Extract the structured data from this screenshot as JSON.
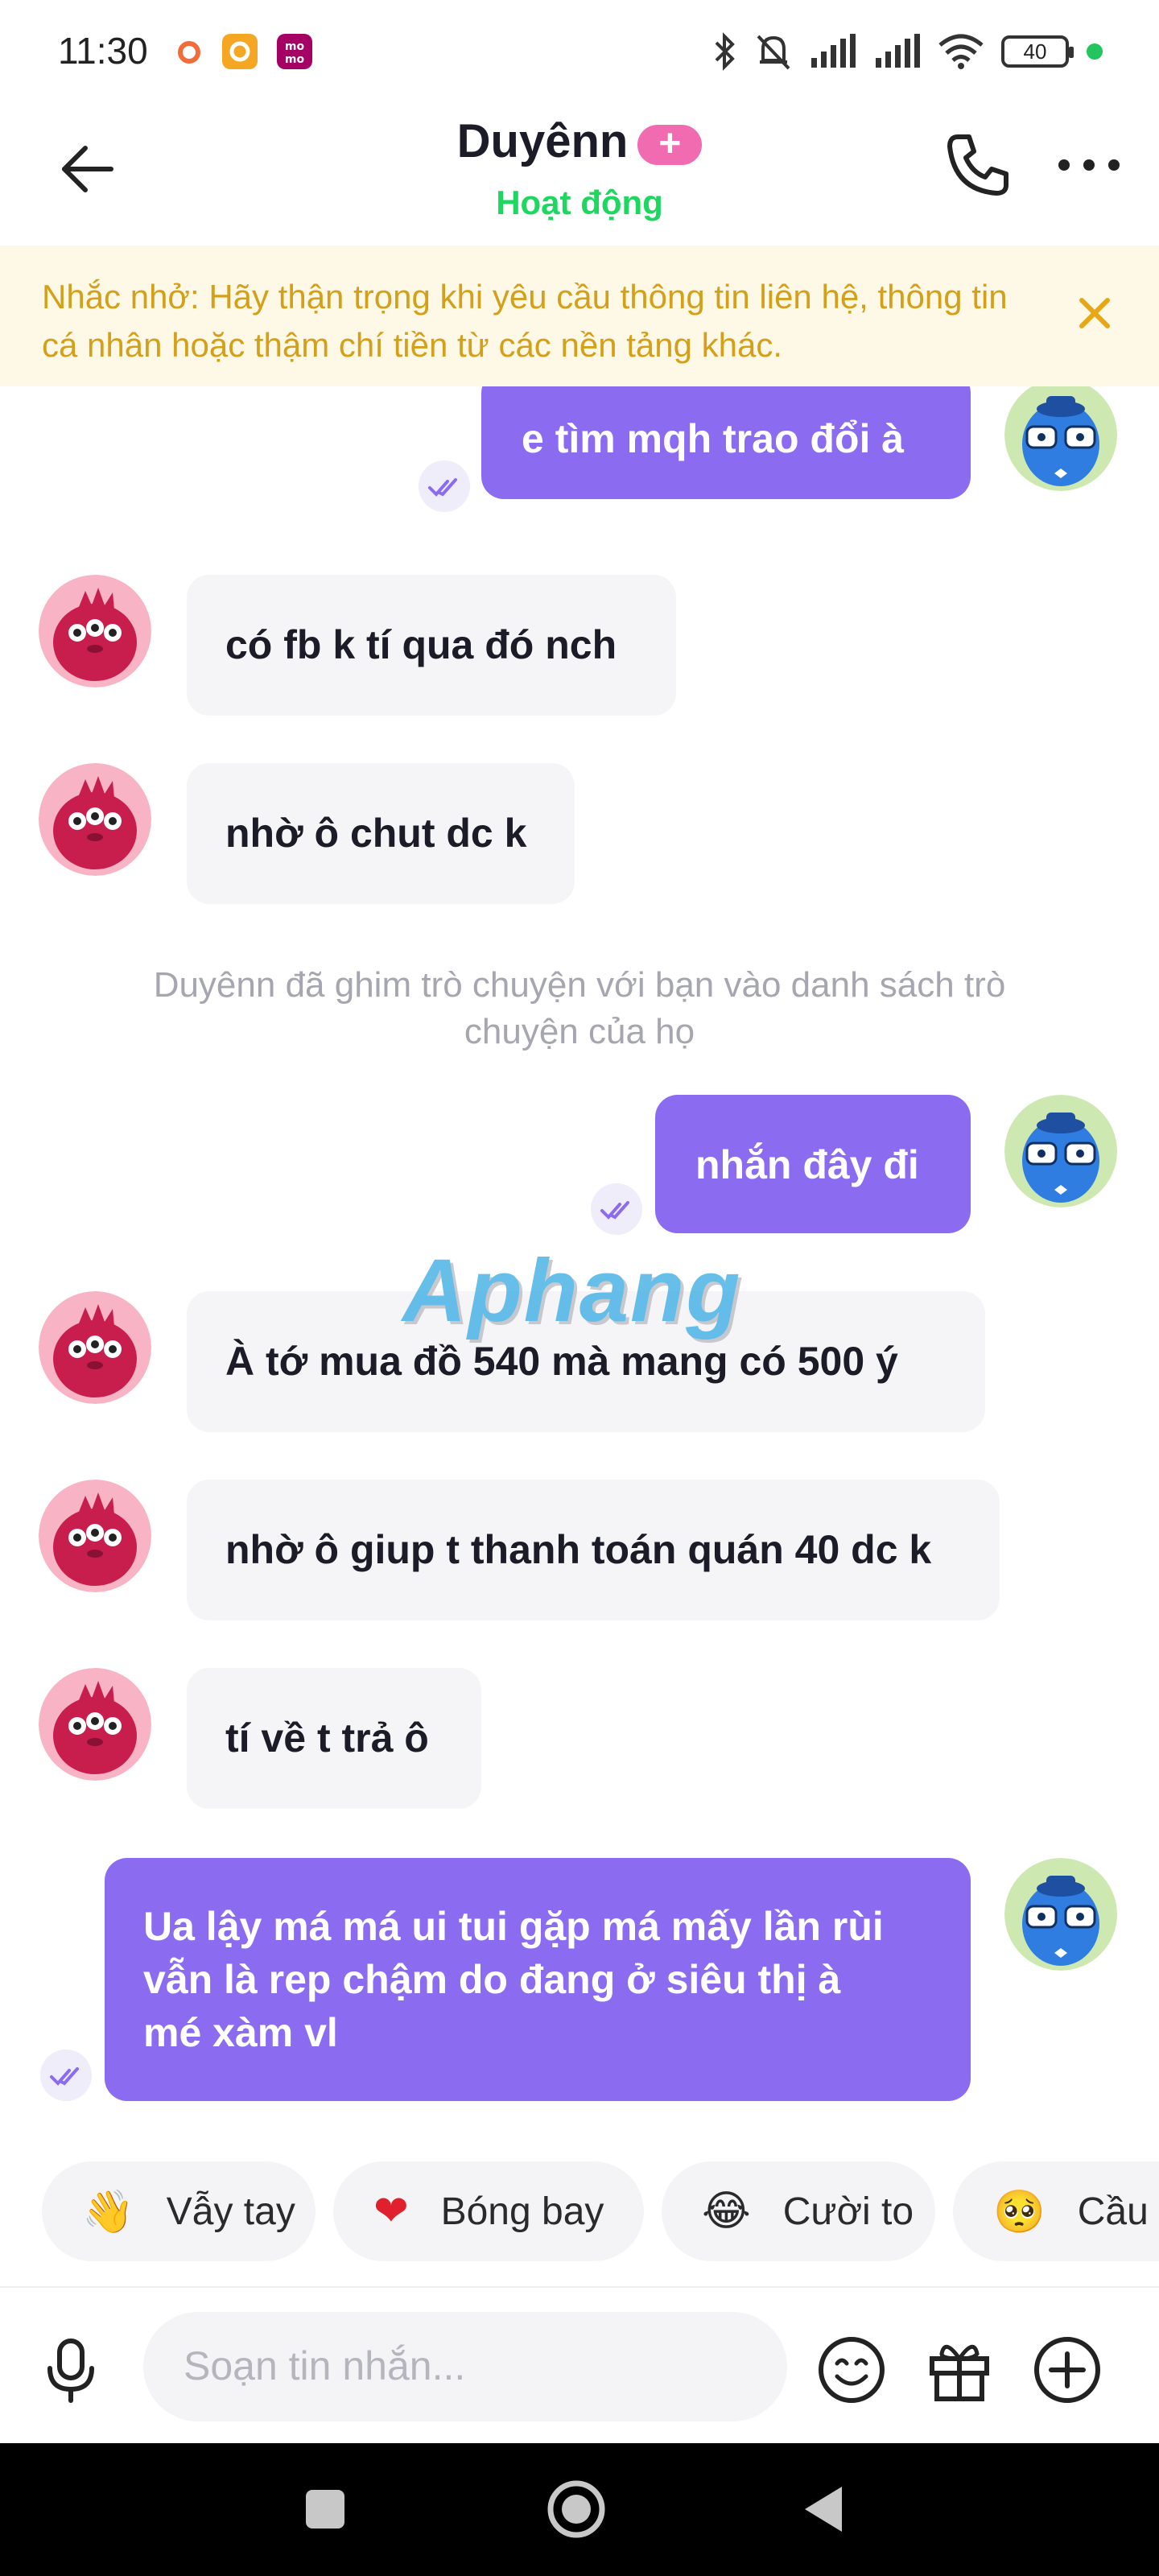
{
  "status_bar": {
    "time": "11:30",
    "battery": "40"
  },
  "header": {
    "contact_name": "Duyênn",
    "plus_badge": "+",
    "status": "Hoạt động"
  },
  "banner": {
    "text": "Nhắc nhở: Hãy thận trọng khi yêu cầu thông tin liên hệ, thông tin cá nhân hoặc thậm chí tiền từ các nền tảng khác."
  },
  "messages": [
    {
      "sender": "me",
      "text": "e tìm mqh trao đổi à"
    },
    {
      "sender": "them",
      "text": "có fb k tí qua đó nch"
    },
    {
      "sender": "them",
      "text": "nhờ ô chut dc k"
    },
    {
      "sender": "system",
      "text": "Duyênn đã ghim trò chuyện với bạn vào danh sách trò chuyện của họ"
    },
    {
      "sender": "me",
      "text": "nhắn đây đi"
    },
    {
      "sender": "them",
      "text": "À tớ mua đồ 540 mà mang có 500 ý"
    },
    {
      "sender": "them",
      "text": "nhờ ô giup t thanh toán quán 40 dc k"
    },
    {
      "sender": "them",
      "text": "tí về t trả ô"
    },
    {
      "sender": "me",
      "lines": [
        "Ua lậy má má ui tui gặp má mấy lần rùi",
        "vẫn là rep chậm do đang ở siêu thị à",
        "mé xàm vl"
      ]
    }
  ],
  "watermark": "Aphang",
  "reactions": [
    {
      "emoji": "👋",
      "label": "Vẫy tay"
    },
    {
      "emoji": "❤",
      "label": "Bóng bay"
    },
    {
      "emoji": "😂",
      "label": "Cười to"
    },
    {
      "emoji": "🥺",
      "label": "Cầu x"
    }
  ],
  "composer": {
    "placeholder": "Soạn tin nhắn..."
  },
  "colors": {
    "accent": "#8b6cf0",
    "online": "#1ed760",
    "banner_text": "#d4a019",
    "banner_bg": "#fef8e7"
  },
  "icons": [
    "back-arrow-icon",
    "phone-icon",
    "more-icon",
    "close-icon",
    "read-tick-icon",
    "microphone-icon",
    "emoji-icon",
    "gift-icon",
    "add-icon"
  ]
}
